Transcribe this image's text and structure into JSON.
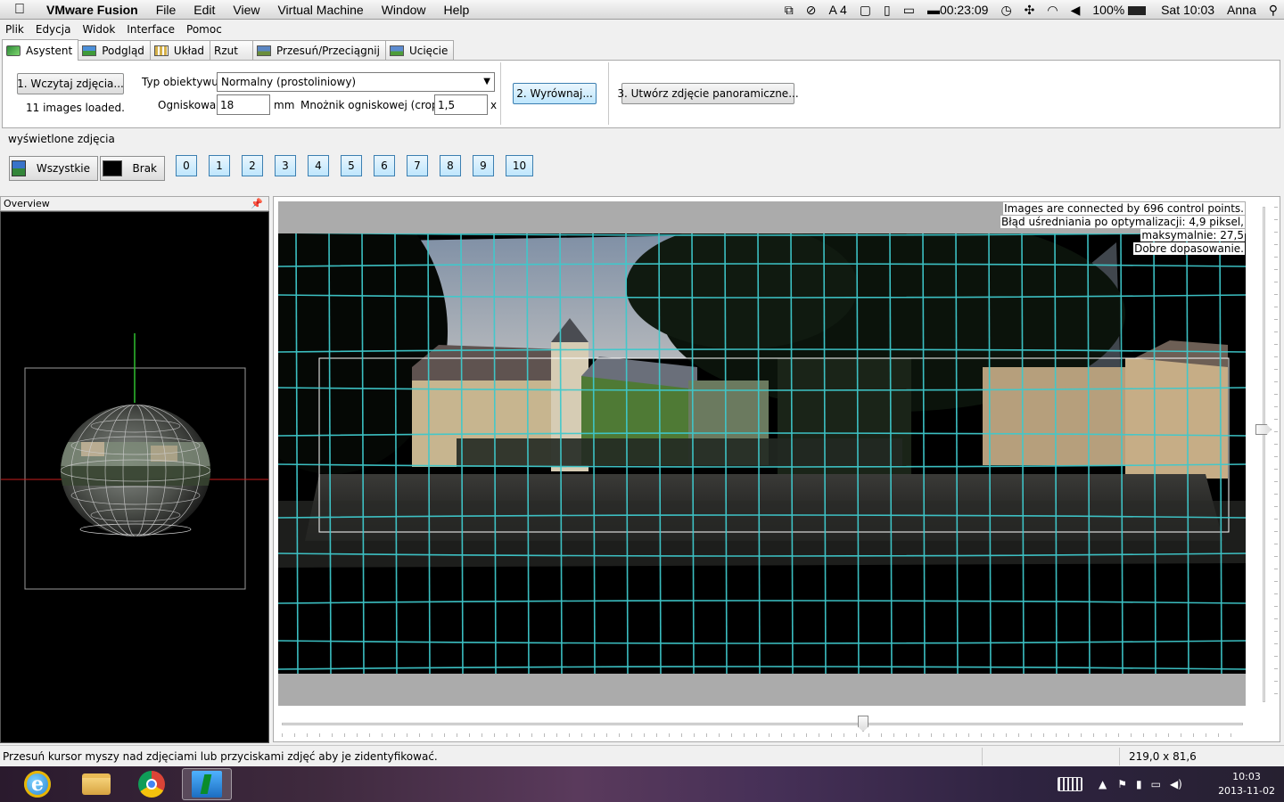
{
  "macbar": {
    "app_name": "VMware Fusion",
    "menu": [
      "File",
      "Edit",
      "View",
      "Virtual Machine",
      "Window",
      "Help"
    ],
    "status": {
      "adobe_count": "4",
      "timer": "00:23:09",
      "battery": "100%",
      "clock": "Sat 10:03",
      "user": "Anna"
    }
  },
  "app_menu": [
    "Plik",
    "Edycja",
    "Widok",
    "Interface",
    "Pomoc"
  ],
  "tabs": [
    {
      "label": "Asystent",
      "icon": "assistant-icon",
      "active": true
    },
    {
      "label": "Podgląd",
      "icon": "preview-icon"
    },
    {
      "label": "Układ",
      "icon": "layout-icon"
    },
    {
      "label": "Rzut"
    },
    {
      "label": "Przesuń/Przeciągnij",
      "icon": "move-drag-icon"
    },
    {
      "label": "Ucięcie",
      "icon": "crop-icon"
    }
  ],
  "assistant": {
    "load_button": "1. Wczytaj zdjęcia...",
    "loaded_status": "11 images loaded.",
    "lens_type_label": "Typ obiektywu:",
    "lens_type_value": "Normalny (prostoliniowy)",
    "focal_label": "Ogniskowa:",
    "focal_value": "18",
    "focal_unit": "mm",
    "crop_label": "Mnożnik ogniskowej (crop):",
    "crop_value": "1,5",
    "crop_unit": "x",
    "align_button": "2. Wyrównaj...",
    "create_button": "3. Utwórz zdjęcie panoramiczne..."
  },
  "displayed": {
    "title": "wyświetlone zdjęcia",
    "all_button": "Wszystkie",
    "none_button": "Brak",
    "images": [
      "0",
      "1",
      "2",
      "3",
      "4",
      "5",
      "6",
      "7",
      "8",
      "9",
      "10"
    ]
  },
  "overview": {
    "title": "Overview"
  },
  "preview": {
    "stats": [
      "Images are connected by 696 control points.",
      "Błąd uśredniania po optymalizacji: 4,9 piksel,",
      "maksymalnie: 27,5",
      "Dobre dopasowanie."
    ]
  },
  "status": {
    "message": "Przesuń kursor myszy nad zdjęciami lub przyciskami zdjęć aby je zidentyfikować.",
    "dimensions": "219,0 x 81,6"
  },
  "taskbar": {
    "apps": [
      "internet-explorer-icon",
      "file-explorer-icon",
      "chrome-icon",
      "hugin-icon"
    ],
    "time": "10:03",
    "date": "2013-11-02"
  },
  "colors": {
    "grid": "#3fc9cc",
    "accent_button": "#bee6fd",
    "overview_green_axis": "#2fbf2f",
    "overview_red_axis": "#c81e1e"
  }
}
